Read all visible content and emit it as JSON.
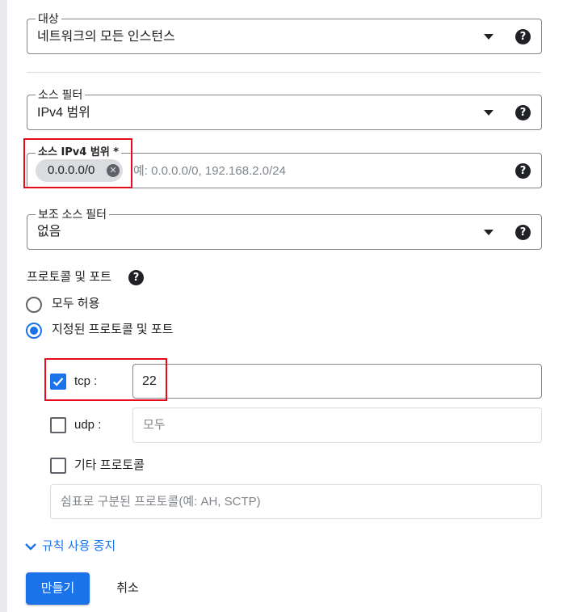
{
  "target": {
    "legend": "대상",
    "value": "네트워크의 모든 인스턴스"
  },
  "source_filter": {
    "legend": "소스 필터",
    "value": "IPv4 범위"
  },
  "source_ipv4": {
    "legend": "소스 IPv4 범위 *",
    "chip": "0.0.0.0/0",
    "chip_remove": "✕",
    "placeholder": "예: 0.0.0.0/0, 192.168.2.0/24"
  },
  "secondary_filter": {
    "legend": "보조 소스 필터",
    "value": "없음"
  },
  "protocols": {
    "title": "프로토콜 및 포트",
    "options": [
      {
        "label": "모두 허용",
        "selected": false
      },
      {
        "label": "지정된 프로토콜 및 포트",
        "selected": true
      }
    ],
    "tcp": {
      "label": "tcp :",
      "checked": true,
      "value": "22"
    },
    "udp": {
      "label": "udp :",
      "checked": false,
      "placeholder": "모두"
    },
    "other": {
      "label": "기타 프로토콜",
      "checked": false,
      "placeholder": "쉼표로 구분된 프로토콜(예: AH, SCTP)"
    }
  },
  "help_glyph": "?",
  "disable_rule_link": "규칙 사용 중지",
  "buttons": {
    "create": "만들기",
    "cancel": "취소"
  },
  "colors": {
    "accent": "#1a73e8",
    "highlight": "#e8091e",
    "text": "#202124",
    "border": "#80868b"
  },
  "icons": [
    "dropdown-arrow-icon",
    "help-icon",
    "chip-remove-icon",
    "checkmark-icon",
    "chevron-down-icon"
  ]
}
